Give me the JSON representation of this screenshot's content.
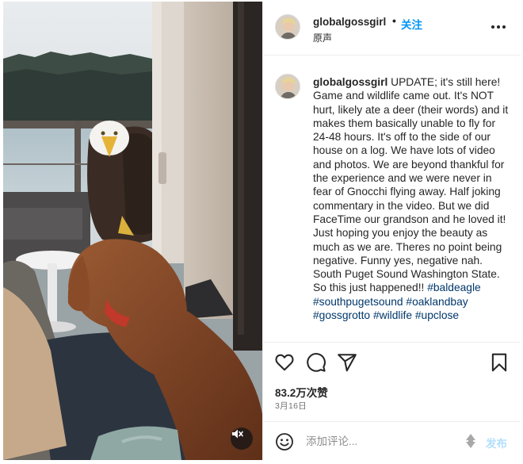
{
  "post": {
    "username": "globalgossgirl",
    "separator": "•",
    "follow_label": "关注",
    "audio_label": "原声",
    "caption": {
      "username": "globalgossgirl",
      "text": " UPDATE; it's still here! Game and wildlife came out. It's NOT hurt, likely ate a deer (their words) and it makes them basically unable to fly for 24-48 hours. It's off to the side of our house on a log. We have lots of video and photos. We are beyond thankful for the experience and we were never in fear of Gnocchi flying away. Half joking commentary in the video. But we did FaceTime our grandson and he loved it! Just hoping you enjoy the beauty as much as we are. Theres no point being negative. Funny yes, negative nah. South Puget Sound Washington State. So this just happened!! ",
      "hashtags": [
        "#baldeagle",
        "#southpugetsound",
        "#oaklandbay",
        "#gossgrotto",
        "#wildlife",
        "#upclose"
      ]
    },
    "likes": "83.2万次赞",
    "date": "3月16日"
  },
  "comment": {
    "placeholder": "添加评论...",
    "post_label": "发布"
  },
  "icons": {
    "more": "more-options-icon",
    "like": "heart-icon",
    "comment": "comment-icon",
    "share": "send-icon",
    "save": "bookmark-icon",
    "emoji": "emoji-icon",
    "mute": "muted-speaker-icon"
  },
  "colors": {
    "follow": "#0095f6",
    "hashtag": "#00376b",
    "post_button_disabled": "#b2dffc"
  }
}
